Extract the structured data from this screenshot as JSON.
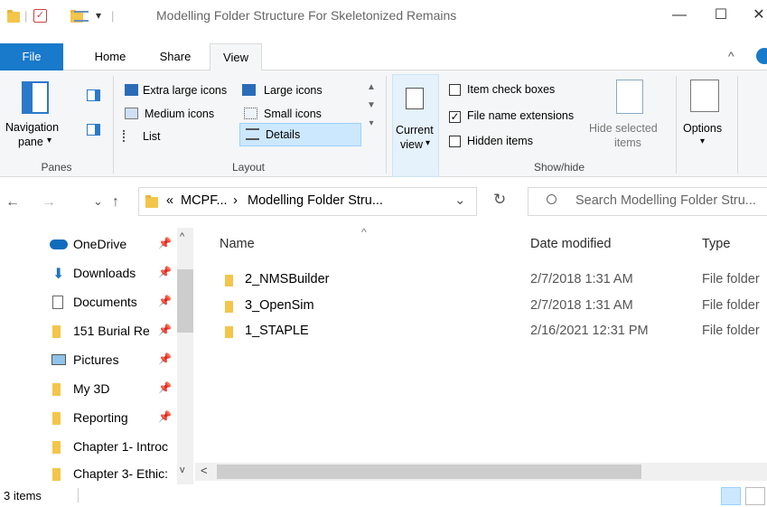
{
  "window": {
    "title": "Modelling Folder Structure For Skeletonized Remains",
    "minimize": "—",
    "maximize": "☐",
    "close": "✕",
    "qat_dropdown": "▾"
  },
  "ribbon_tabs": [
    {
      "label": "File"
    },
    {
      "label": "Home"
    },
    {
      "label": "Share"
    },
    {
      "label": "View"
    }
  ],
  "ribbon": {
    "panes": {
      "navigation_pane_line1": "Navigation",
      "navigation_pane_line2": "pane",
      "navigation_pane_arrow": "▾",
      "group_label": "Panes"
    },
    "layout": {
      "extra_large_icons": "Extra large icons",
      "large_icons": "Large icons",
      "medium_icons": "Medium icons",
      "small_icons": "Small icons",
      "list": "List",
      "details": "Details",
      "group_label": "Layout"
    },
    "current_view": {
      "line1": "Current",
      "line2": "view",
      "arrow": "▾"
    },
    "show_hide": {
      "item_check_boxes": "Item check boxes",
      "file_name_extensions": "File name extensions",
      "hidden_items": "Hidden items",
      "hide_selected_line1": "Hide selected",
      "hide_selected_line2": "items",
      "group_label": "Show/hide",
      "item_check_boxes_checked": false,
      "file_name_extensions_checked": true,
      "hidden_items_checked": false
    },
    "options": {
      "label": "Options",
      "arrow": "▾"
    }
  },
  "address": {
    "back": "←",
    "forward": "→",
    "recent": "⌄",
    "up": "↑",
    "overflow": "«",
    "crumb1": "MCPF...",
    "separator": "›",
    "crumb2": "Modelling Folder Stru...",
    "dropdown": "⌄",
    "refresh": "↻",
    "search_placeholder": "Search Modelling Folder Stru..."
  },
  "nav_pane": [
    {
      "label": "OneDrive",
      "icon": "onedrive-icon"
    },
    {
      "label": "Downloads",
      "icon": "downloads-icon"
    },
    {
      "label": "Documents",
      "icon": "documents-icon"
    },
    {
      "label": "151 Burial Re",
      "icon": "folder-icon"
    },
    {
      "label": "Pictures",
      "icon": "pictures-icon"
    },
    {
      "label": "My 3D",
      "icon": "folder-icon"
    },
    {
      "label": "Reporting",
      "icon": "folder-icon"
    },
    {
      "label": "Chapter 1- Introc",
      "icon": "folder-icon"
    },
    {
      "label": "Chapter 3- Ethic:",
      "icon": "folder-icon"
    }
  ],
  "columns": {
    "name": "Name",
    "date_modified": "Date modified",
    "type": "Type",
    "sort_indicator": "^"
  },
  "files": [
    {
      "name": "2_NMSBuilder",
      "date": "2/7/2018 1:31 AM",
      "type": "File folder"
    },
    {
      "name": "3_OpenSim",
      "date": "2/7/2018 1:31 AM",
      "type": "File folder"
    },
    {
      "name": "1_STAPLE",
      "date": "2/16/2021 12:31 PM",
      "type": "File folder"
    }
  ],
  "status": {
    "item_count": "3 items"
  },
  "colors": {
    "accent": "#1979ca",
    "folder": "#f3c54b",
    "selected_bg": "#cce8ff"
  }
}
